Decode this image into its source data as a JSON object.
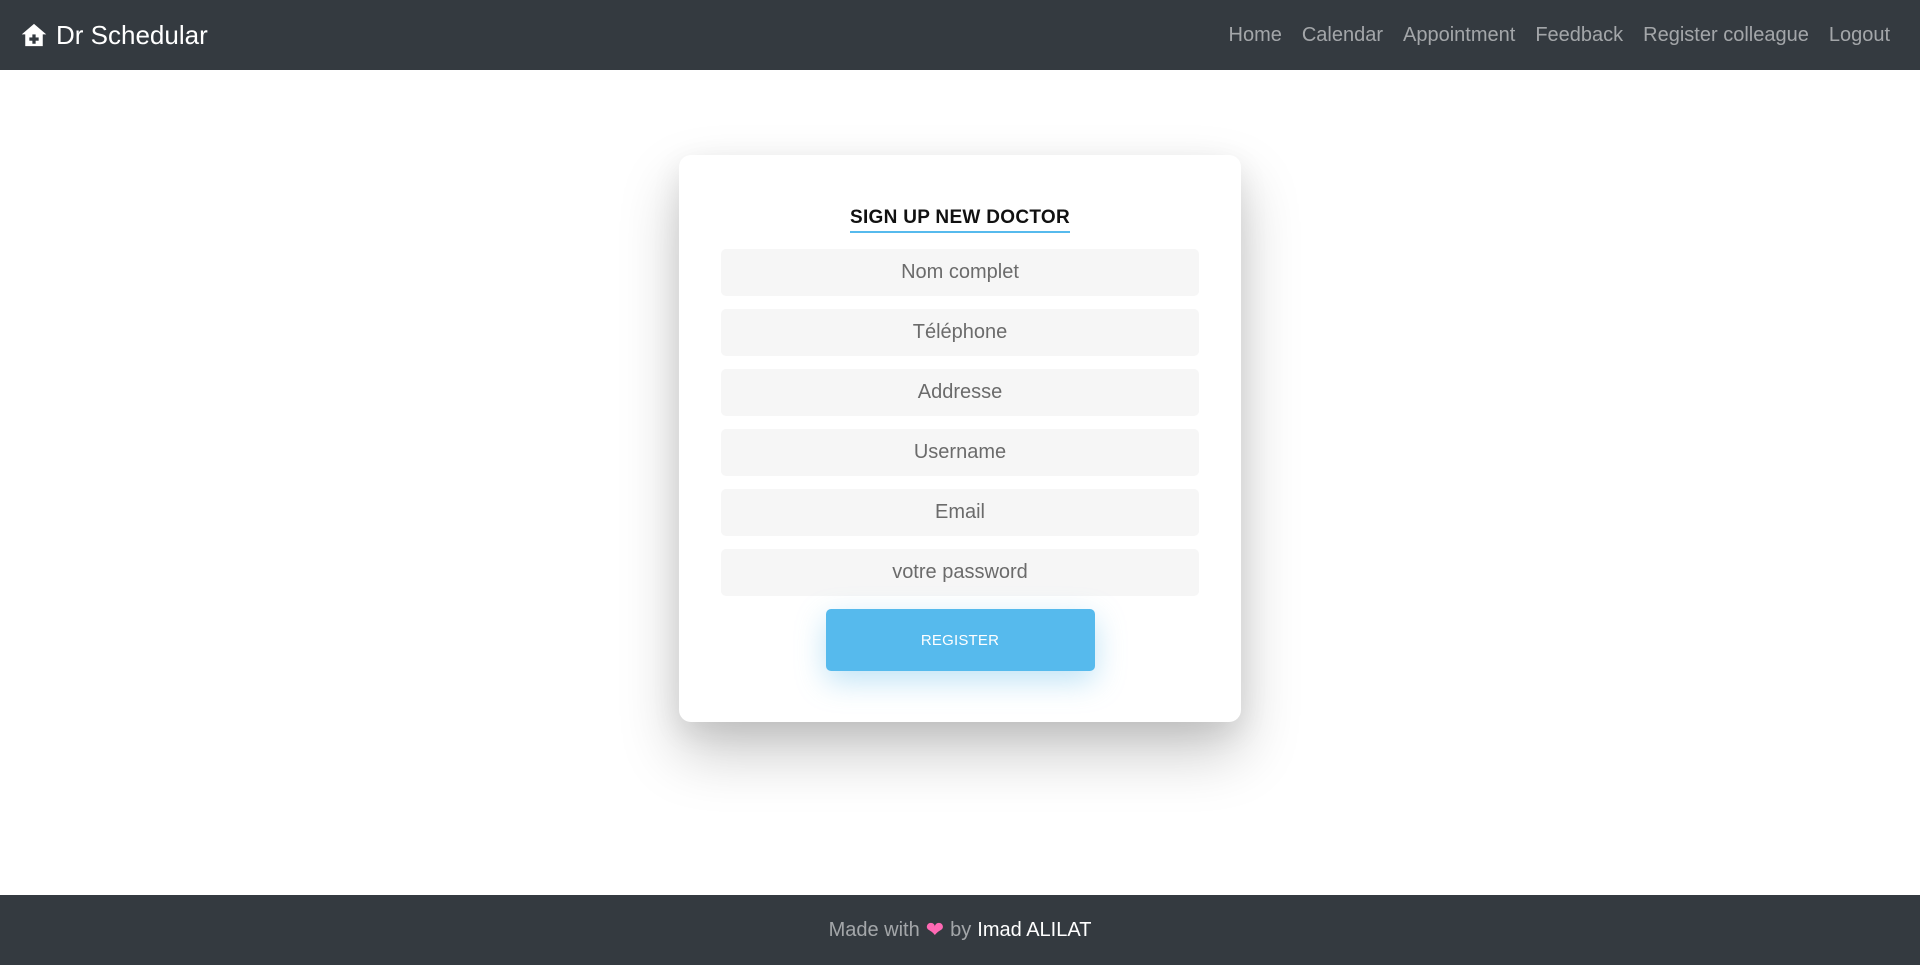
{
  "navbar": {
    "brand": "Dr Schedular",
    "brand_icon": "home-icon",
    "links": [
      "Home",
      "Calendar",
      "Appointment",
      "Feedback",
      "Register colleague",
      "Logout"
    ]
  },
  "form": {
    "title": "SIGN UP NEW DOCTOR",
    "fields": [
      {
        "placeholder": "Nom complet",
        "value": ""
      },
      {
        "placeholder": "Téléphone",
        "value": ""
      },
      {
        "placeholder": "Addresse",
        "value": ""
      },
      {
        "placeholder": "Username",
        "value": ""
      },
      {
        "placeholder": "Email",
        "value": ""
      },
      {
        "placeholder": "votre password",
        "value": ""
      }
    ],
    "submit_label": "REGISTER"
  },
  "footer": {
    "prefix": "Made with",
    "heart_icon": "heart-icon",
    "by": "by",
    "author": "Imad ALILAT"
  },
  "colors": {
    "navbar_bg": "#343a40",
    "accent": "#56baed",
    "field_bg": "#f6f6f6",
    "heart": "#ff69b4"
  }
}
